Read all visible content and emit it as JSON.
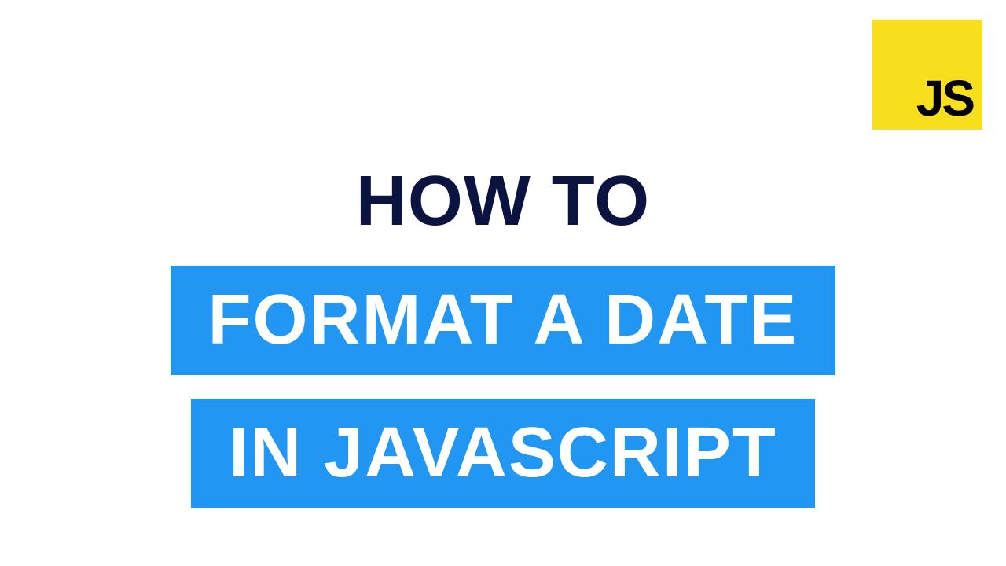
{
  "logo": {
    "text": "JS"
  },
  "title": {
    "line1": "HOW TO",
    "line2": "FORMAT A DATE",
    "line3": "IN JAVASCRIPT"
  },
  "colors": {
    "jsYellow": "#F7DF1E",
    "darkNavy": "#0B1340",
    "brightBlue": "#2196F3"
  }
}
